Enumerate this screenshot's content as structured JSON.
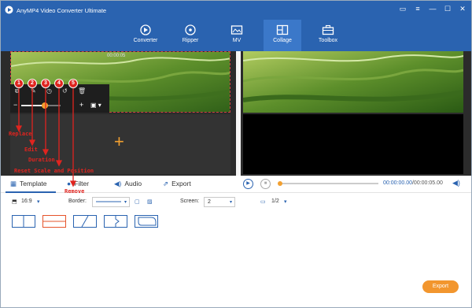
{
  "app": {
    "title": "AnyMP4 Video Converter Ultimate"
  },
  "window_controls": [
    {
      "name": "feedback-icon",
      "glyph": "▭"
    },
    {
      "name": "menu-icon",
      "glyph": "≡"
    },
    {
      "name": "minimize-icon",
      "glyph": "—"
    },
    {
      "name": "maximize-icon",
      "glyph": "☐"
    },
    {
      "name": "close-icon",
      "glyph": "✕"
    }
  ],
  "nav": [
    {
      "label": "Converter"
    },
    {
      "label": "Ripper"
    },
    {
      "label": "MV"
    },
    {
      "label": "Collage"
    },
    {
      "label": "Toolbox"
    }
  ],
  "editor": {
    "timecode": "00:00:05",
    "zoom_level": 0.6
  },
  "tabs": [
    {
      "label": "Template",
      "icon": "template-icon"
    },
    {
      "label": "Filter",
      "icon": "filter-icon"
    },
    {
      "label": "Audio",
      "icon": "audio-icon"
    },
    {
      "label": "Export",
      "icon": "export-icon"
    }
  ],
  "player": {
    "current": "00:00:00.00",
    "total": "/00:00:05.00",
    "progress": 0.0
  },
  "options": {
    "aspect": "16:9",
    "border_label": "Border:",
    "screen_label": "Screen:",
    "screen_value": "2",
    "page": "1/2"
  },
  "annotations": {
    "markers": [
      "1",
      "2",
      "3",
      "4",
      "5"
    ],
    "labels": [
      "Replace",
      "Edit",
      "Duration",
      "Reset Scale and Position",
      "Remove"
    ]
  },
  "export_button": "Export",
  "colors": {
    "brand": "#2a63b0",
    "accent": "#f2962e",
    "annotation": "#e0241f"
  }
}
